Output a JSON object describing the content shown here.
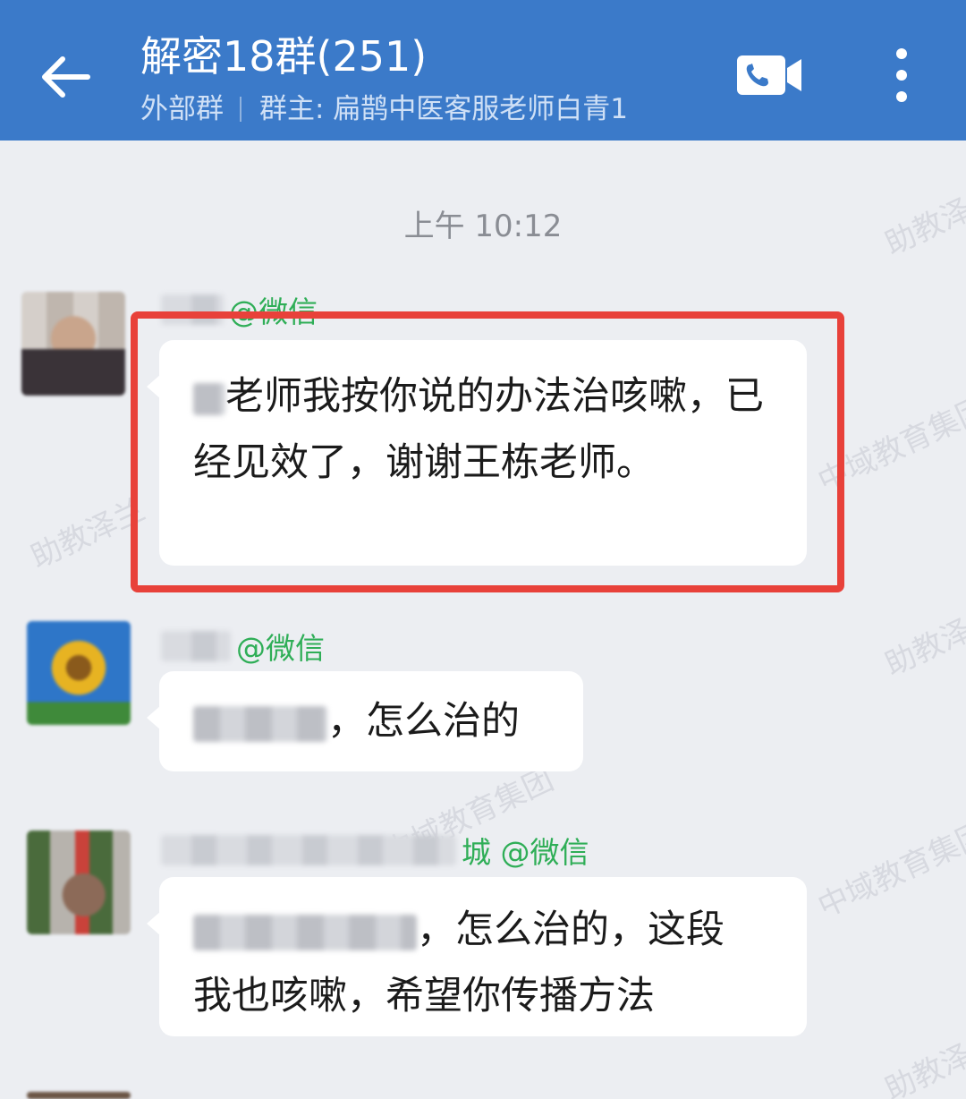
{
  "header": {
    "back_icon": "arrow-left-icon",
    "title": "解密18群(251)",
    "group_type": "外部群",
    "owner": "群主: 扁鹊中医客服老师白青1",
    "video_icon": "video-call-icon",
    "more_icon": "more-vertical-icon"
  },
  "watermark": {
    "text_1": "助教泽",
    "text_2": "中域教育集团",
    "text_3": "助教泽兰",
    "text_4": "中域教育集团"
  },
  "chat": {
    "time": "上午 10:12",
    "messages": [
      {
        "sender_suffix": "@微信",
        "text_after_redact": "老师我按你说的办法治咳嗽，已经见效了，谢谢王栋老师。",
        "highlighted": true
      },
      {
        "sender_suffix": "@微信",
        "text_after_redact": "，怎么治的"
      },
      {
        "sender_suffix": "城 @微信",
        "text_line1_after_redact": "，怎么治的，这段",
        "text_line2": "我也咳嗽，希望你传播方法"
      }
    ]
  },
  "colors": {
    "header_bg": "#3b7ac9",
    "chat_bg": "#eceef2",
    "sender_green": "#2fae57",
    "highlight_red": "#e8413a"
  }
}
